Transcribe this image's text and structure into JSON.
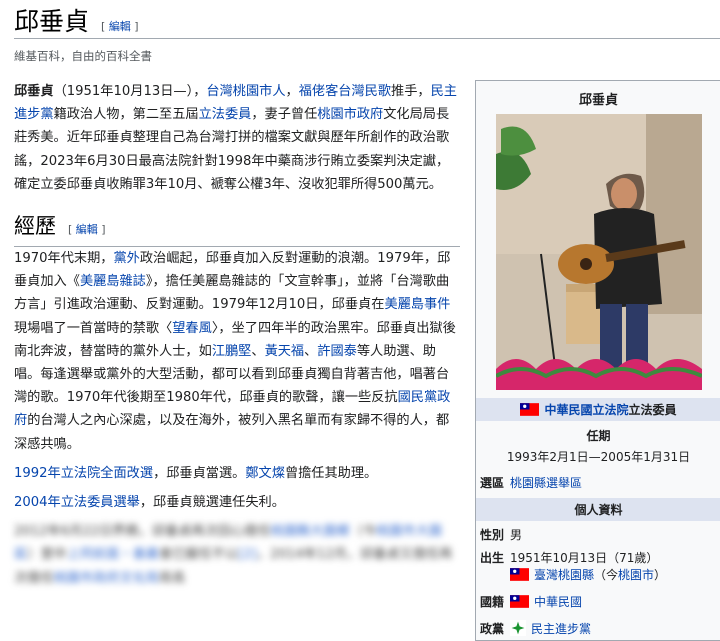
{
  "page": {
    "title": "邱垂貞",
    "edit_label": "編輯",
    "tagline": "維基百科，自由的百科全書"
  },
  "lead": {
    "segments": [
      {
        "t": "邱垂貞",
        "b": true
      },
      {
        "t": "（1951年10月13日—），"
      },
      {
        "t": "台灣桃園市人",
        "l": true
      },
      {
        "t": "，"
      },
      {
        "t": "福佬客台灣民歌",
        "l": true
      },
      {
        "t": "推手，"
      },
      {
        "t": "民主進步黨",
        "l": true
      },
      {
        "t": "籍政治人物，第二至五屆"
      },
      {
        "t": "立法委員",
        "l": true
      },
      {
        "t": "，妻子曾任"
      },
      {
        "t": "桃園市政府",
        "l": true
      },
      {
        "t": "文化局局長莊秀美。近年邱垂貞整理自己為台灣打拼的檔案文獻與歷年所創作的政治歌謠，2023年6月30日最高法院針對1998年中藥商涉行賄立委案判決定讞，確定立委邱垂貞收賄罪3年10月、褫奪公權3年、沒收犯罪所得500萬元。"
      }
    ]
  },
  "section": {
    "heading": "經歷",
    "edit_label": "編輯",
    "p1": [
      {
        "t": "1970年代末期，"
      },
      {
        "t": "黨外",
        "l": true
      },
      {
        "t": "政治崛起，邱垂貞加入反對運動的浪潮。1979年，邱垂貞加入《"
      },
      {
        "t": "美麗島雜誌",
        "l": true
      },
      {
        "t": "》，擔任美麗島雜誌的「文宣幹事」，並將「台灣歌曲方言」引進政治運動、反對運動。1979年12月10日，邱垂貞在"
      },
      {
        "t": "美麗島事件",
        "l": true
      },
      {
        "t": "現場唱了一首當時的禁歌〈"
      },
      {
        "t": "望春風",
        "l": true
      },
      {
        "t": "〉，坐了四年半的政治黑牢。邱垂貞出獄後南北奔波，替當時的黨外人士，如"
      },
      {
        "t": "江鵬堅",
        "l": true
      },
      {
        "t": "、"
      },
      {
        "t": "黃天福",
        "l": true
      },
      {
        "t": "、"
      },
      {
        "t": "許國泰",
        "l": true
      },
      {
        "t": "等人助選、助唱。每逢選舉或黨外的大型活動，都可以看到邱垂貞獨自背著吉他，唱著台灣的歌。1970年代後期至1980年代，邱垂貞的歌聲，讓一些反抗"
      },
      {
        "t": "國民黨政府",
        "l": true
      },
      {
        "t": "的台灣人之內心深處，以及在海外，被列入黑名單而有家歸不得的人，都深感共鳴。"
      }
    ],
    "p2": [
      {
        "t": "1992年立法院全面改選",
        "l": true
      },
      {
        "t": "，邱垂貞當選。"
      },
      {
        "t": "鄭文燦",
        "l": true
      },
      {
        "t": "曾擔任其助理。"
      }
    ],
    "p3": [
      {
        "t": "2004年立法委員選舉",
        "l": true
      },
      {
        "t": "，邱垂貞競選連任失利。"
      }
    ],
    "p4": [
      {
        "t": "2012年6月22日界務，邱垂貞再次回心擔任"
      },
      {
        "t": "桃園縣大園鄉",
        "l": true
      },
      {
        "t": "（今"
      },
      {
        "t": "桃園市大園區",
        "l": true
      },
      {
        "t": "）里中"
      },
      {
        "t": "上同前面・善義",
        "l": true
      },
      {
        "t": "會已擬任不以"
      },
      {
        "t": "[2]",
        "l": true
      },
      {
        "t": "，2014年12月，邱垂貞又擔任再次擔任"
      },
      {
        "t": "桃園市政府文化局",
        "l": true
      },
      {
        "t": "局長"
      }
    ]
  },
  "infobox": {
    "title": "邱垂貞",
    "office_link": "中華民國立法院",
    "office_suffix": "立法委員",
    "term_label": "任期",
    "term_value": "1993年2月1日—2005年1月31日",
    "district_key": "選區",
    "district_value": "桃園縣選舉區",
    "personal_header": "個人資料",
    "gender_key": "性別",
    "gender_value": "男",
    "birth_key": "出生",
    "birth_value": "1951年10月13日（71歲）",
    "birth_place_link": "臺灣桃園縣",
    "birth_place_note_pre": "（今",
    "birth_place_note_link": "桃園市",
    "birth_place_note_post": "）",
    "nationality_key": "國籍",
    "nationality_value": "中華民國",
    "party_key": "政黨",
    "party_value": "民主進步黨"
  },
  "icons": {
    "flag": "roc-flag-icon",
    "party": "dpp-logo-icon",
    "photo": "portrait-with-guitar"
  },
  "colors": {
    "link": "#0645ad",
    "infobox_bg": "#f8f9fa",
    "infobox_header": "#dde3f0"
  }
}
